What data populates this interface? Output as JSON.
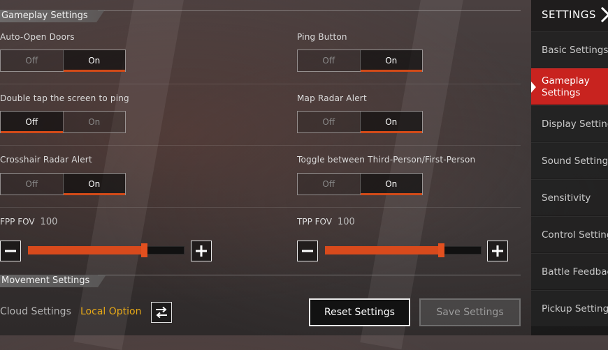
{
  "gameplay_settings": {
    "header": "Gameplay Settings",
    "options": [
      {
        "label": "Auto-Open Doors",
        "off": "Off",
        "on": "On",
        "selected": "On"
      },
      {
        "label": "Ping Button",
        "off": "Off",
        "on": "On",
        "selected": "On"
      },
      {
        "label": "Double tap the screen to ping",
        "off": "Off",
        "on": "On",
        "selected": "Off"
      },
      {
        "label": "Map Radar Alert",
        "off": "Off",
        "on": "On",
        "selected": "On"
      },
      {
        "label": "Crosshair Radar Alert",
        "off": "Off",
        "on": "On",
        "selected": "On"
      },
      {
        "label": "Toggle between Third-Person/First-Person",
        "off": "Off",
        "on": "On",
        "selected": "On"
      }
    ],
    "fpp_fov": {
      "label": "FPP FOV",
      "value": "100",
      "level": 0.74
    },
    "tpp_fov": {
      "label": "TPP FOV",
      "value": "100",
      "level": 0.74
    }
  },
  "movement_settings": {
    "header": "Movement Settings"
  },
  "bottom_bar": {
    "cloud_label": "Cloud Settings",
    "local_option": "Local Option",
    "reset_button": "Reset Settings",
    "save_button": "Save Settings"
  },
  "sidebar": {
    "title": "SETTINGS",
    "items": [
      {
        "label": "Basic Settings"
      },
      {
        "label": "Gameplay Settings",
        "active": true
      },
      {
        "label": "Display Settings"
      },
      {
        "label": "Sound Settings"
      },
      {
        "label": "Sensitivity"
      },
      {
        "label": "Control Settings"
      },
      {
        "label": "Battle Feedback"
      },
      {
        "label": "Pickup Settings"
      }
    ]
  },
  "colors": {
    "accent": "#d84a1c",
    "active_tab": "#c8231f",
    "local_option": "#e6a817"
  },
  "icons": [
    "minus-icon",
    "plus-icon",
    "swap-arrows-icon",
    "chevron-right-icon"
  ]
}
